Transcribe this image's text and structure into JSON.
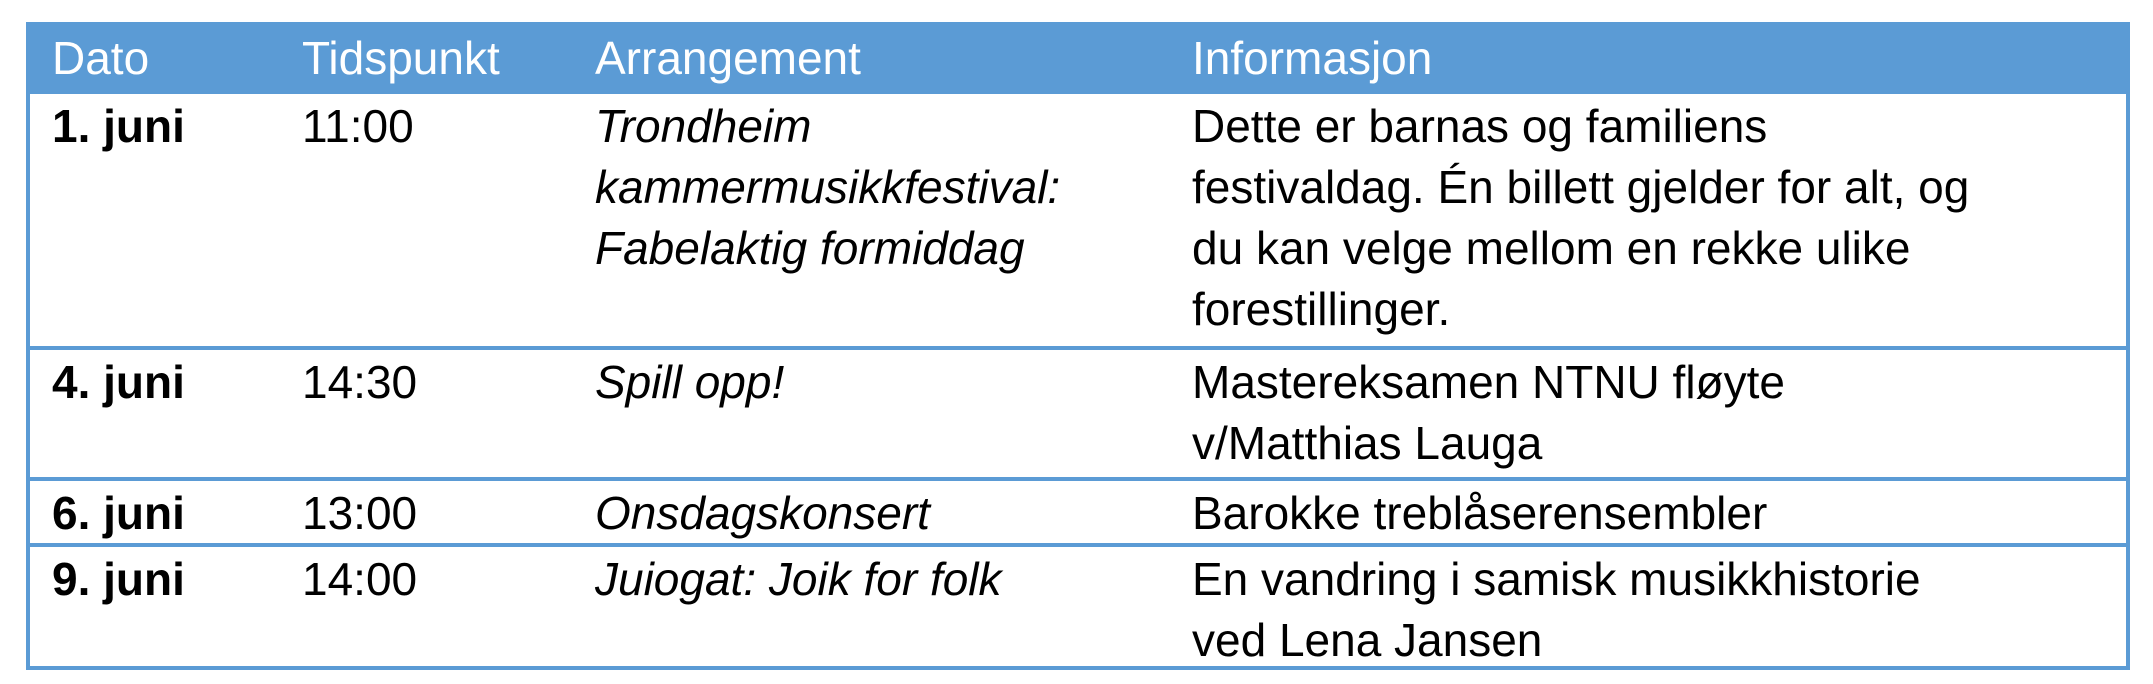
{
  "table": {
    "headers": {
      "date": "Dato",
      "time": "Tidspunkt",
      "event": "Arrangement",
      "info": "Informasjon"
    },
    "rows": [
      {
        "date": "1. juni",
        "time": "11:00",
        "event": "Trondheim\nkammermusikkfestival:\nFabelaktig formiddag",
        "info": "Dette er barnas og familiens\nfestivaldag. Én billett gjelder for alt, og\ndu kan velge mellom en rekke ulike\nforestillinger."
      },
      {
        "date": "4. juni",
        "time": "14:30",
        "event": "Spill opp!",
        "info": "Mastereksamen NTNU fløyte\nv/Matthias Lauga"
      },
      {
        "date": "6. juni",
        "time": "13:00",
        "event": "Onsdagskonsert",
        "info": "Barokke treblåserensembler"
      },
      {
        "date": "9. juni",
        "time": "14:00",
        "event": "Juiogat: Joik for folk",
        "info": "En vandring i samisk musikkhistorie\nved Lena Jansen"
      }
    ]
  },
  "colors": {
    "header_background": "#5b9bd5",
    "header_text": "#ffffff",
    "border": "#5b9bd5",
    "text": "#000000"
  }
}
